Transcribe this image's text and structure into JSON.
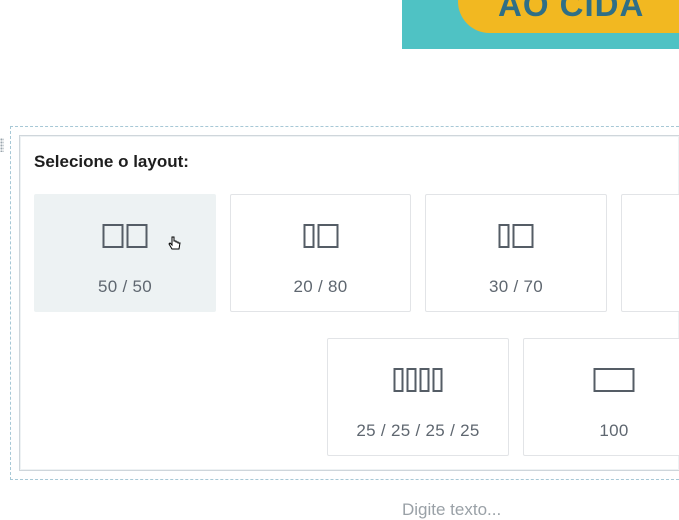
{
  "banner": {
    "text": "AO CIDA",
    "colors": {
      "background": "#4fc2c4",
      "pill": "#f2b821",
      "text": "#2f6f86"
    }
  },
  "layout_picker": {
    "title": "Selecione o layout:",
    "options": [
      {
        "label": "50 / 50",
        "selected": true
      },
      {
        "label": "20 / 80",
        "selected": false
      },
      {
        "label": "30 / 70",
        "selected": false
      },
      {
        "label": "",
        "selected": false
      },
      {
        "label": "25 / 25 / 25 / 25",
        "selected": false
      },
      {
        "label": "100",
        "selected": false
      }
    ]
  },
  "editor": {
    "placeholder": "Digite texto..."
  }
}
